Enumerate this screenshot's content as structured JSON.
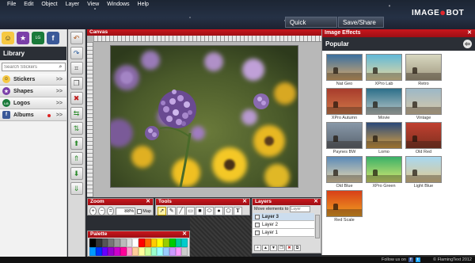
{
  "menu": [
    "File",
    "Edit",
    "Object",
    "Layer",
    "View",
    "Windows",
    "Help"
  ],
  "header": {
    "quick_start": "Quick Start",
    "quick_arrows": ">>>",
    "save_share": "Save/Share",
    "logo": "IMAGE",
    "logo_b": "BOT"
  },
  "library": {
    "title": "Library",
    "search_placeholder": "Search Stickers",
    "categories": [
      {
        "label": "Stickers",
        "chev": ">>"
      },
      {
        "label": "Shapes",
        "chev": ">>"
      },
      {
        "label": "Logos",
        "chev": ">>"
      },
      {
        "label": "Albums",
        "chev": ">>"
      }
    ]
  },
  "canvas": {
    "title": "Canvas",
    "close": "✕"
  },
  "zoom": {
    "title": "Zoom",
    "value": "88%",
    "checkbox_label": "Map"
  },
  "tools": {
    "title": "Tools",
    "text_tool": "T"
  },
  "layers": {
    "title": "Layers",
    "move_label": "Move elements to",
    "move_placeholder": "Layer",
    "items": [
      "Layer 3",
      "Layer 2",
      "Layer 1"
    ]
  },
  "palette": {
    "title": "Palette",
    "colors": [
      "#000000",
      "#333333",
      "#555555",
      "#777777",
      "#999999",
      "#bbbbbb",
      "#dddddd",
      "#ffffff",
      "#ff0000",
      "#ff6600",
      "#ffcc00",
      "#ffff00",
      "#99cc00",
      "#00cc00",
      "#00cc99",
      "#00cccc",
      "#0099ff",
      "#0033ff",
      "#6600ff",
      "#9900cc",
      "#cc00cc",
      "#ff0099",
      "#ff99cc",
      "#ffcc99",
      "#ffff99",
      "#ccff99",
      "#99ffcc",
      "#99ffff",
      "#99ccff",
      "#cc99ff",
      "#ff99ff",
      "#cccccc"
    ]
  },
  "effects": {
    "title": "Image Effects",
    "category": "Popular",
    "back": "⇦",
    "items": [
      {
        "label": "Nat Geo",
        "c1": "#3a6fa0",
        "c2": "#d7a96a"
      },
      {
        "label": "XPro Lab",
        "c1": "#60b8d8",
        "c2": "#e8d8a0"
      },
      {
        "label": "Retro",
        "c1": "#d8d8c0",
        "c2": "#a09880"
      },
      {
        "label": "XPro Autumn",
        "c1": "#a83c2c",
        "c2": "#d07848"
      },
      {
        "label": "Movie",
        "c1": "#2c6f8a",
        "c2": "#b8c8c8"
      },
      {
        "label": "Vintage",
        "c1": "#9cb8c8",
        "c2": "#d8c8a8"
      },
      {
        "label": "Paynes BW",
        "c1": "#8898a8",
        "c2": "#5a6470"
      },
      {
        "label": "Lomo",
        "c1": "#2a4a7a",
        "c2": "#d8a040"
      },
      {
        "label": "Old Red",
        "c1": "#c04030",
        "c2": "#803020"
      },
      {
        "label": "Old Blue",
        "c1": "#5a8ab8",
        "c2": "#e8d8b0"
      },
      {
        "label": "XPro Green",
        "c1": "#3ab068",
        "c2": "#d8e870"
      },
      {
        "label": "Light Blue",
        "c1": "#a8d8f0",
        "c2": "#e0c890"
      },
      {
        "label": "Red Scale",
        "c1": "#d84018",
        "c2": "#f0a020"
      }
    ]
  },
  "footer": {
    "follow": "Follow us on",
    "copyright": "© FlamingText 2012"
  }
}
